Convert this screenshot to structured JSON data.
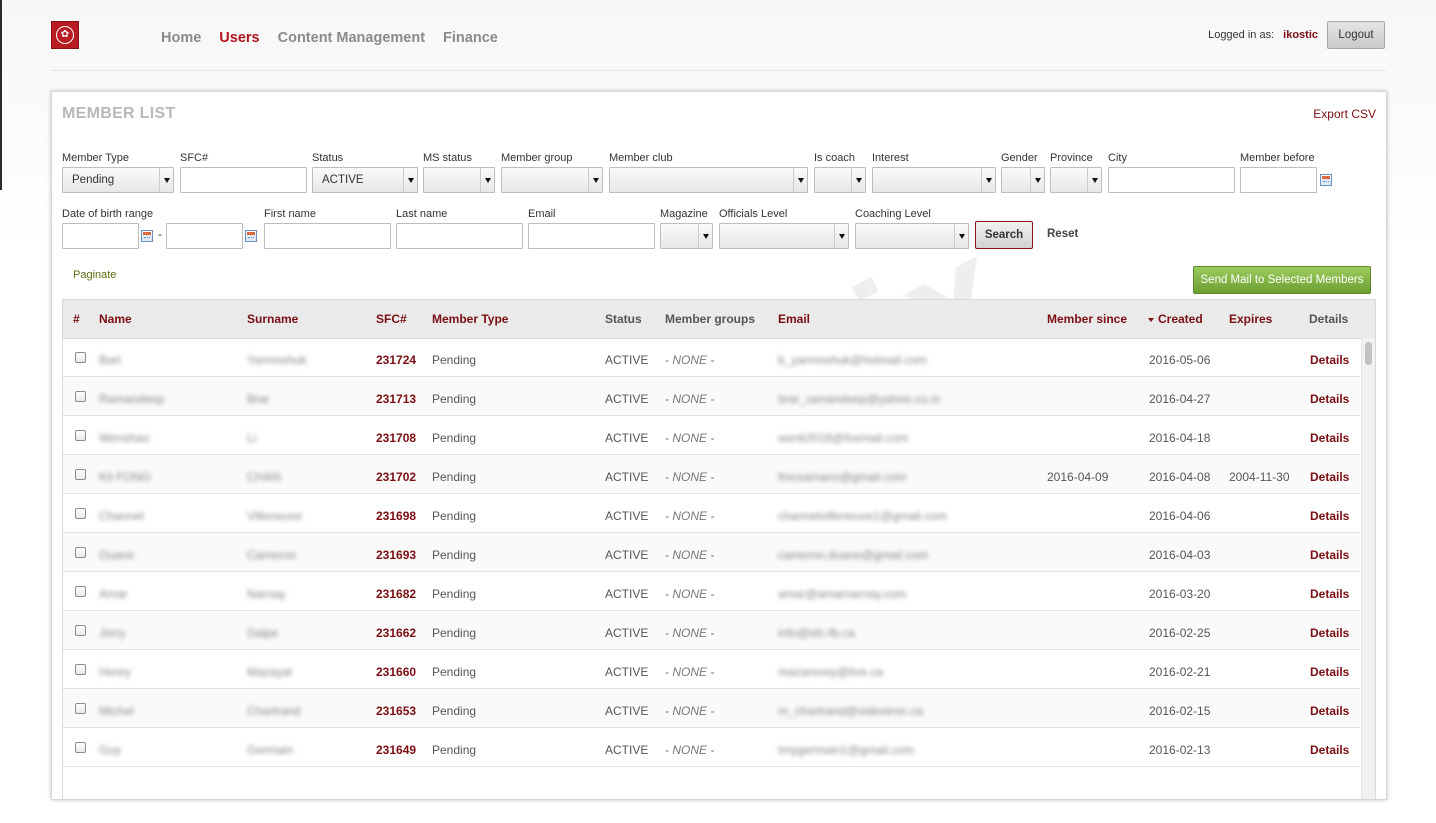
{
  "app": {
    "logo_icon": "canada-maple-leaf-logo-icon",
    "nav": [
      {
        "label": "Home",
        "active": false
      },
      {
        "label": "Users",
        "active": true
      },
      {
        "label": "Content Management",
        "active": false
      },
      {
        "label": "Finance",
        "active": false
      }
    ],
    "logged_in_label": "Logged in as:",
    "username": "ikostic",
    "logout_label": "Logout"
  },
  "colors": {
    "brand_red": "#b0161f",
    "dark_red": "#7a0e12",
    "green_button": "#7fb043"
  },
  "panel": {
    "title": "MEMBER LIST",
    "export_label": "Export CSV"
  },
  "filters": {
    "member_type": {
      "label": "Member Type",
      "value": "Pending"
    },
    "sfc": {
      "label": "SFC#",
      "value": ""
    },
    "status": {
      "label": "Status",
      "value": "ACTIVE"
    },
    "ms_status": {
      "label": "MS status",
      "value": ""
    },
    "member_group": {
      "label": "Member group",
      "value": ""
    },
    "member_club": {
      "label": "Member club",
      "value": ""
    },
    "is_coach": {
      "label": "Is coach",
      "value": ""
    },
    "interest": {
      "label": "Interest",
      "value": ""
    },
    "gender": {
      "label": "Gender",
      "value": ""
    },
    "province": {
      "label": "Province",
      "value": ""
    },
    "city": {
      "label": "City",
      "value": ""
    },
    "member_before": {
      "label": "Member before",
      "value": ""
    },
    "dob_range": {
      "label": "Date of birth range",
      "separator": "-",
      "from": "",
      "to": ""
    },
    "first_name": {
      "label": "First name",
      "value": ""
    },
    "last_name": {
      "label": "Last name",
      "value": ""
    },
    "email": {
      "label": "Email",
      "value": ""
    },
    "magazine": {
      "label": "Magazine",
      "value": ""
    },
    "officials_level": {
      "label": "Officials Level",
      "value": ""
    },
    "coaching_level": {
      "label": "Coaching Level",
      "value": ""
    },
    "search_label": "Search",
    "reset_label": "Reset"
  },
  "list_controls": {
    "paginate_label": "Paginate",
    "send_mail_label": "Send Mail to Selected Members"
  },
  "table": {
    "columns": [
      "#",
      "Name",
      "Surname",
      "SFC#",
      "Member Type",
      "Status",
      "Member groups",
      "Email",
      "Member since",
      "Created",
      "Expires",
      "Details"
    ],
    "sorted_column": "Created",
    "rows": [
      {
        "name": "Bart",
        "surname": "Yarmoshuk",
        "sfc": "231724",
        "type": "Pending",
        "status": "ACTIVE",
        "groups": "- NONE -",
        "email": "b_yarmoshuk@hotmail.com",
        "since": "",
        "created": "2016-05-06",
        "expires": "",
        "details": "Details"
      },
      {
        "name": "Ramandeep",
        "surname": "Brar",
        "sfc": "231713",
        "type": "Pending",
        "status": "ACTIVE",
        "groups": "- NONE -",
        "email": "brar_ramandeep@yahoo.co.in",
        "since": "",
        "created": "2016-04-27",
        "expires": "",
        "details": "Details"
      },
      {
        "name": "Wenshao",
        "surname": "Li",
        "sfc": "231708",
        "type": "Pending",
        "status": "ACTIVE",
        "groups": "- NONE -",
        "email": "wenli2016@foxmail.com",
        "since": "",
        "created": "2016-04-18",
        "expires": "",
        "details": "Details"
      },
      {
        "name": "Kit FONG",
        "surname": "CHAN",
        "sfc": "231702",
        "type": "Pending",
        "status": "ACTIVE",
        "groups": "- NONE -",
        "email": "fmcsamans@gmail.com",
        "since": "2016-04-09",
        "created": "2016-04-08",
        "expires": "2004-11-30",
        "details": "Details"
      },
      {
        "name": "Channel",
        "surname": "Villeneuve",
        "sfc": "231698",
        "type": "Pending",
        "status": "ACTIVE",
        "groups": "- NONE -",
        "email": "channelvilleneuve1@gmail.com",
        "since": "",
        "created": "2016-04-06",
        "expires": "",
        "details": "Details"
      },
      {
        "name": "Duane",
        "surname": "Cameron",
        "sfc": "231693",
        "type": "Pending",
        "status": "ACTIVE",
        "groups": "- NONE -",
        "email": "cameron.duane@gmail.com",
        "since": "",
        "created": "2016-04-03",
        "expires": "",
        "details": "Details"
      },
      {
        "name": "Amar",
        "surname": "Narnay",
        "sfc": "231682",
        "type": "Pending",
        "status": "ACTIVE",
        "groups": "- NONE -",
        "email": "amar@amarnarnay.com",
        "since": "",
        "created": "2016-03-20",
        "expires": "",
        "details": "Details"
      },
      {
        "name": "Jerry",
        "surname": "Dalpe",
        "sfc": "231662",
        "type": "Pending",
        "status": "ACTIVE",
        "groups": "- NONE -",
        "email": "info@sfc-fb.ca",
        "since": "",
        "created": "2016-02-25",
        "expires": "",
        "details": "Details"
      },
      {
        "name": "Henry",
        "surname": "Mazayal",
        "sfc": "231660",
        "type": "Pending",
        "status": "ACTIVE",
        "groups": "- NONE -",
        "email": "mazarevey@live.ca",
        "since": "",
        "created": "2016-02-21",
        "expires": "",
        "details": "Details"
      },
      {
        "name": "Michel",
        "surname": "Chartrand",
        "sfc": "231653",
        "type": "Pending",
        "status": "ACTIVE",
        "groups": "- NONE -",
        "email": "m_chartrand@videotron.ca",
        "since": "",
        "created": "2016-02-15",
        "expires": "",
        "details": "Details"
      },
      {
        "name": "Guy",
        "surname": "Germain",
        "sfc": "231649",
        "type": "Pending",
        "status": "ACTIVE",
        "groups": "- NONE -",
        "email": "tmygermain1@gmail.com",
        "since": "",
        "created": "2016-02-13",
        "expires": "",
        "details": "Details"
      }
    ]
  },
  "watermark": "open kinetix"
}
